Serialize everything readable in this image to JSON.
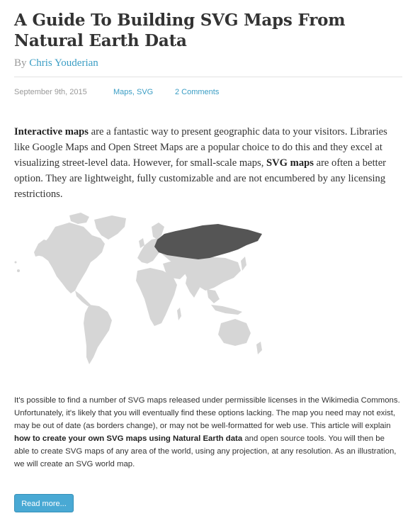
{
  "article": {
    "title": "A Guide To Building SVG Maps From Natural Earth Data",
    "byline_prefix": "By",
    "author": "Chris Youderian",
    "date": "September 9th, 2015",
    "categories": "Maps, SVG",
    "comments": "2 Comments"
  },
  "lead": {
    "part1_bold": "Interactive maps",
    "part2": " are a fantastic way to present geographic data to your visitors. Libraries like Google Maps and Open Street Maps are a popular choice to do this and they excel at visualizing street-level data. However, for small-scale maps, ",
    "part3_bold": "SVG maps",
    "part4": " are often a better option. They are lightweight, fully customizable and are not encumbered by any licensing restrictions."
  },
  "map": {
    "land_color": "#d6d6d6",
    "highlight_color": "#555555",
    "highlight_region": "Russia"
  },
  "body": {
    "part1": "It's possible to find a number of SVG maps released under permissible licenses in the Wikimedia Commons. Unfortunately, it's likely that you will eventually find these options lacking. The map you need may not exist, may be out of date (as borders change), or may not be well-formatted for web use. This article will explain ",
    "part2_bold": "how to create your own SVG maps using Natural Earth data",
    "part3": " and open source tools. You will then be able to create SVG maps of any area of the world, using any projection, at any resolution. As an illustration, we will create an SVG world map."
  },
  "read_more": {
    "label": "Read more..."
  }
}
